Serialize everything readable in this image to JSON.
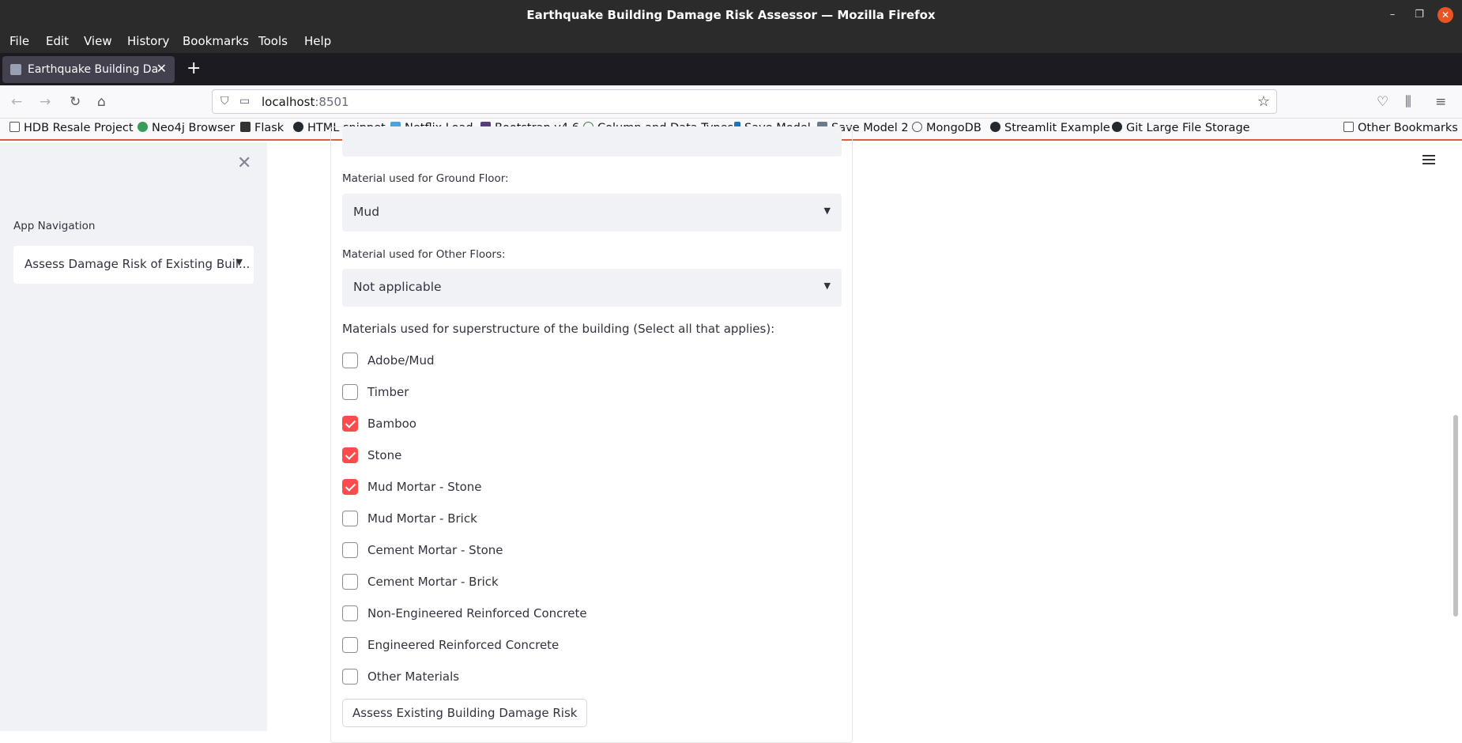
{
  "window": {
    "title": "Earthquake Building Damage Risk Assessor — Mozilla Firefox"
  },
  "menu": [
    "File",
    "Edit",
    "View",
    "History",
    "Bookmarks",
    "Tools",
    "Help"
  ],
  "tab": {
    "label": "Earthquake Building Damage Risk Assessor"
  },
  "url": {
    "host": "localhost",
    "port": ":8501"
  },
  "bookmarks": [
    "HDB Resale Project",
    "Neo4j Browser",
    "Flask",
    "HTML snippet",
    "Netflix Load",
    "Bootstrap v4.6",
    "Column and Data Types",
    "Save Model",
    "Save Model 2",
    "MongoDB",
    "Streamlit Example",
    "Git Large File Storage",
    "Other Bookmarks"
  ],
  "sidebar": {
    "nav_label": "App Navigation",
    "nav_value": "Assess Damage Risk of Existing Buil..."
  },
  "form": {
    "ground_floor_label": "Material used for Ground Floor:",
    "ground_floor_value": "Mud",
    "other_floors_label": "Material used for Other Floors:",
    "other_floors_value": "Not applicable",
    "superstructure_label": "Materials used for superstructure of the building (Select all that applies):",
    "materials": [
      {
        "label": "Adobe/Mud",
        "checked": false
      },
      {
        "label": "Timber",
        "checked": false
      },
      {
        "label": "Bamboo",
        "checked": true
      },
      {
        "label": "Stone",
        "checked": true
      },
      {
        "label": "Mud Mortar - Stone",
        "checked": true
      },
      {
        "label": "Mud Mortar - Brick",
        "checked": false
      },
      {
        "label": "Cement Mortar - Stone",
        "checked": false
      },
      {
        "label": "Cement Mortar - Brick",
        "checked": false
      },
      {
        "label": "Non-Engineered Reinforced Concrete",
        "checked": false
      },
      {
        "label": "Engineered Reinforced Concrete",
        "checked": false
      },
      {
        "label": "Other Materials",
        "checked": false
      }
    ],
    "submit_label": "Assess Existing Building Damage Risk"
  },
  "colors": {
    "accent": "#ff4b4b",
    "sidebar_bg": "#f0f2f6",
    "titlebar": "#2b2b2b"
  }
}
